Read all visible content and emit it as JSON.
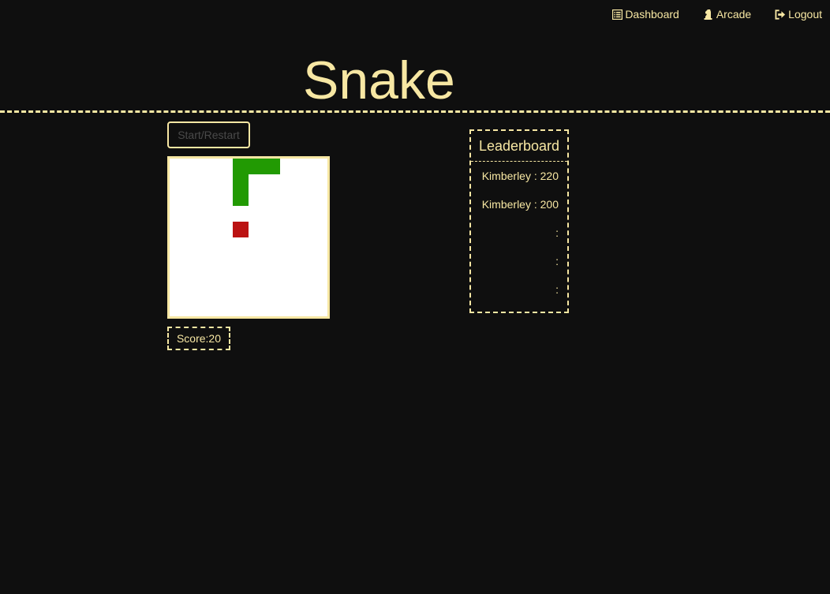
{
  "nav": {
    "items": [
      {
        "label": "Dashboard",
        "icon": "list-icon"
      },
      {
        "label": "Arcade",
        "icon": "chess-knight-icon"
      },
      {
        "label": "Logout",
        "icon": "logout-icon"
      }
    ]
  },
  "title": "Snake",
  "controls": {
    "start_label": "Start/Restart"
  },
  "score": {
    "text": "Score:20"
  },
  "leaderboard": {
    "title": "Leaderboard",
    "entries": [
      {
        "text": "Kimberley : 220"
      },
      {
        "text": "Kimberley : 200"
      },
      {
        "text": ":"
      },
      {
        "text": ":"
      },
      {
        "text": ":"
      }
    ]
  },
  "colors": {
    "accent": "#f7e7a3",
    "background": "#0f0f0f",
    "board": "#ffffff",
    "snake": "#229a03",
    "food": "#bb1212"
  },
  "game": {
    "grid_columns": 10,
    "grid_rows": 10,
    "snake_cells": [
      [
        4,
        0
      ],
      [
        5,
        0
      ],
      [
        6,
        0
      ],
      [
        4,
        1
      ],
      [
        4,
        2
      ]
    ],
    "food_cell": [
      4,
      4
    ]
  }
}
